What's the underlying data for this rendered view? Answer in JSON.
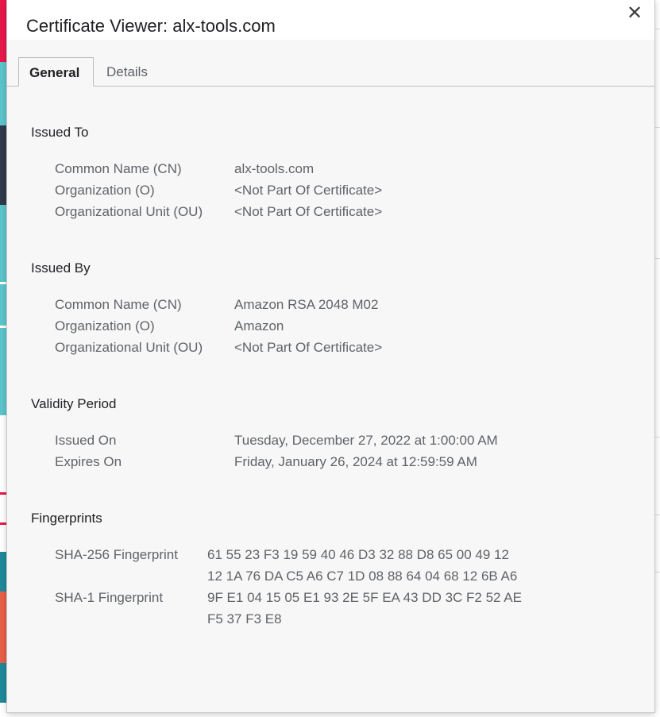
{
  "dialog": {
    "title": "Certificate Viewer: alx-tools.com",
    "close_symbol": "✕"
  },
  "tabs": [
    {
      "label": "General",
      "active": true
    },
    {
      "label": "Details",
      "active": false
    }
  ],
  "issued_to": {
    "heading": "Issued To",
    "rows": [
      {
        "label": "Common Name (CN)",
        "value": "alx-tools.com"
      },
      {
        "label": "Organization (O)",
        "value": "<Not Part Of Certificate>"
      },
      {
        "label": "Organizational Unit (OU)",
        "value": "<Not Part Of Certificate>"
      }
    ]
  },
  "issued_by": {
    "heading": "Issued By",
    "rows": [
      {
        "label": "Common Name (CN)",
        "value": "Amazon RSA 2048 M02"
      },
      {
        "label": "Organization (O)",
        "value": "Amazon"
      },
      {
        "label": "Organizational Unit (OU)",
        "value": "<Not Part Of Certificate>"
      }
    ]
  },
  "validity": {
    "heading": "Validity Period",
    "rows": [
      {
        "label": "Issued On",
        "value": "Tuesday, December 27, 2022 at 1:00:00 AM"
      },
      {
        "label": "Expires On",
        "value": "Friday, January 26, 2024 at 12:59:59 AM"
      }
    ]
  },
  "fingerprints": {
    "heading": "Fingerprints",
    "sha256": {
      "label": "SHA-256 Fingerprint",
      "line1": "61 55 23 F3 19 59 40 46 D3 32 88 D8 65 00 49 12",
      "line2": "12 1A 76 DA C5 A6 C7 1D 08 88 64 04 68 12 6B A6"
    },
    "sha1": {
      "label": "SHA-1 Fingerprint",
      "line1": "9F E1 04 15 05 E1 93 2E 5F EA 43 DD 3C F2 52 AE",
      "line2": "F5 37 F3 E8"
    }
  },
  "colors": {
    "dialog_bg": "#f7f7f7",
    "bg_pink": "#e8174a",
    "bg_teal": "#5bc5c9",
    "bg_dark": "#2f3a4a",
    "bg_orange": "#e8604a"
  }
}
